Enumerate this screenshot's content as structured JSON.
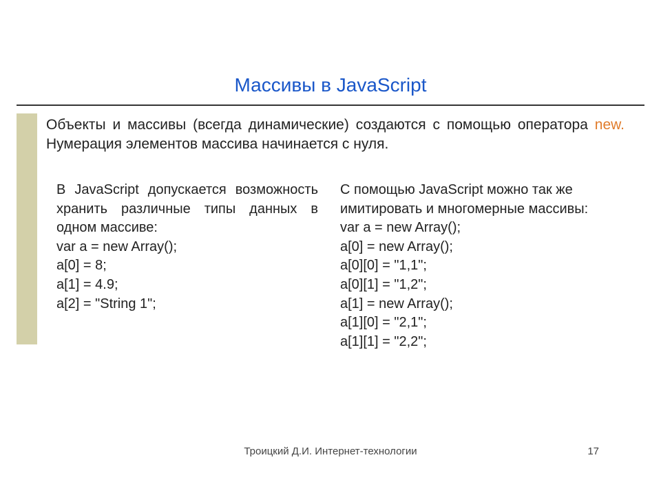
{
  "title": "Массивы в JavaScript",
  "intro": {
    "part1": "Объекты и массивы (всегда динамические) создаются с помощью оператора ",
    "kw": "new.",
    "part2": " Нумерация элементов массива начинается с нуля."
  },
  "left": {
    "text": "В JavaScript допускается возможность хранить различные типы данных в одном массиве:",
    "code": "var a = new Array();\na[0] = 8;\na[1] = 4.9;\na[2] = \"String 1\";"
  },
  "right": {
    "text": "С помощью JavaScript можно так же имитировать и многомерные массивы:",
    "code": "var a = new Array();\na[0] = new Array();\na[0][0] = \"1,1\";\na[0][1] = \"1,2\";\na[1] = new Array();\na[1][0] = \"2,1\";\na[1][1] = \"2,2\";"
  },
  "footer": {
    "author": "Троицкий Д.И. Интернет-технологии",
    "page": "17"
  }
}
